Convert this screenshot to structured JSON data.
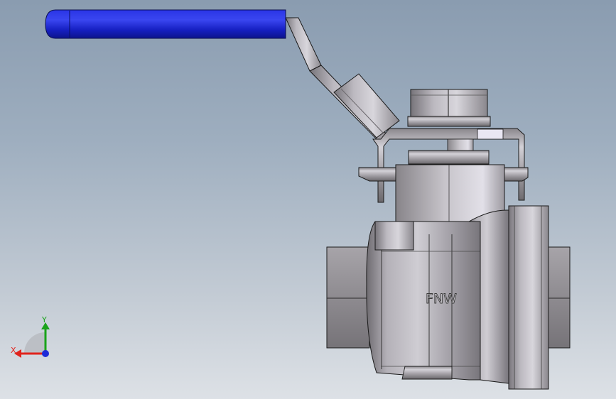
{
  "model": {
    "brand_mark": "FNW"
  },
  "triad": {
    "x_label": "X",
    "y_label": "Y"
  },
  "colors": {
    "handle_grip": "#1a23d6",
    "metal_light": "#e6e4ec",
    "metal_mid": "#a9a6ad",
    "metal_dark": "#6e6b70",
    "axis_x": "#e0241d",
    "axis_y": "#1aa31a",
    "axis_z": "#1e2bd8"
  }
}
